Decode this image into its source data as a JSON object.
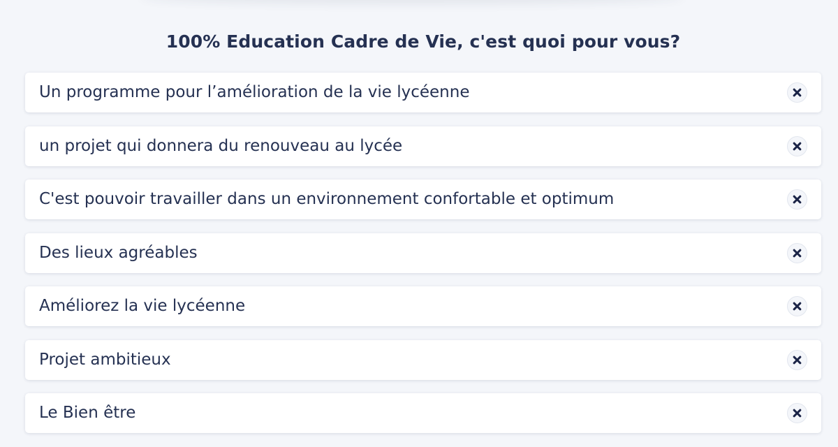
{
  "header": {
    "title": "100% Education Cadre de Vie, c'est quoi pour vous?"
  },
  "answers": [
    {
      "text": "Un programme pour l’amélioration de la vie lycéenne",
      "action_icon": "close-icon"
    },
    {
      "text": "un projet qui donnera du renouveau au lycée",
      "action_icon": "close-icon"
    },
    {
      "text": "C'est pouvoir travailler dans un environnement confortable et optimum",
      "action_icon": "close-icon"
    },
    {
      "text": "Des lieux agréables",
      "action_icon": "close-icon"
    },
    {
      "text": "Améliorez la vie lycéenne",
      "action_icon": "close-icon"
    },
    {
      "text": "Projet ambitieux",
      "action_icon": "close-icon"
    },
    {
      "text": "Le Bien être",
      "action_icon": "close-icon"
    }
  ],
  "colors": {
    "background": "#f4f6fa",
    "card": "#ffffff",
    "text": "#253152",
    "icon": "#1b2447"
  }
}
